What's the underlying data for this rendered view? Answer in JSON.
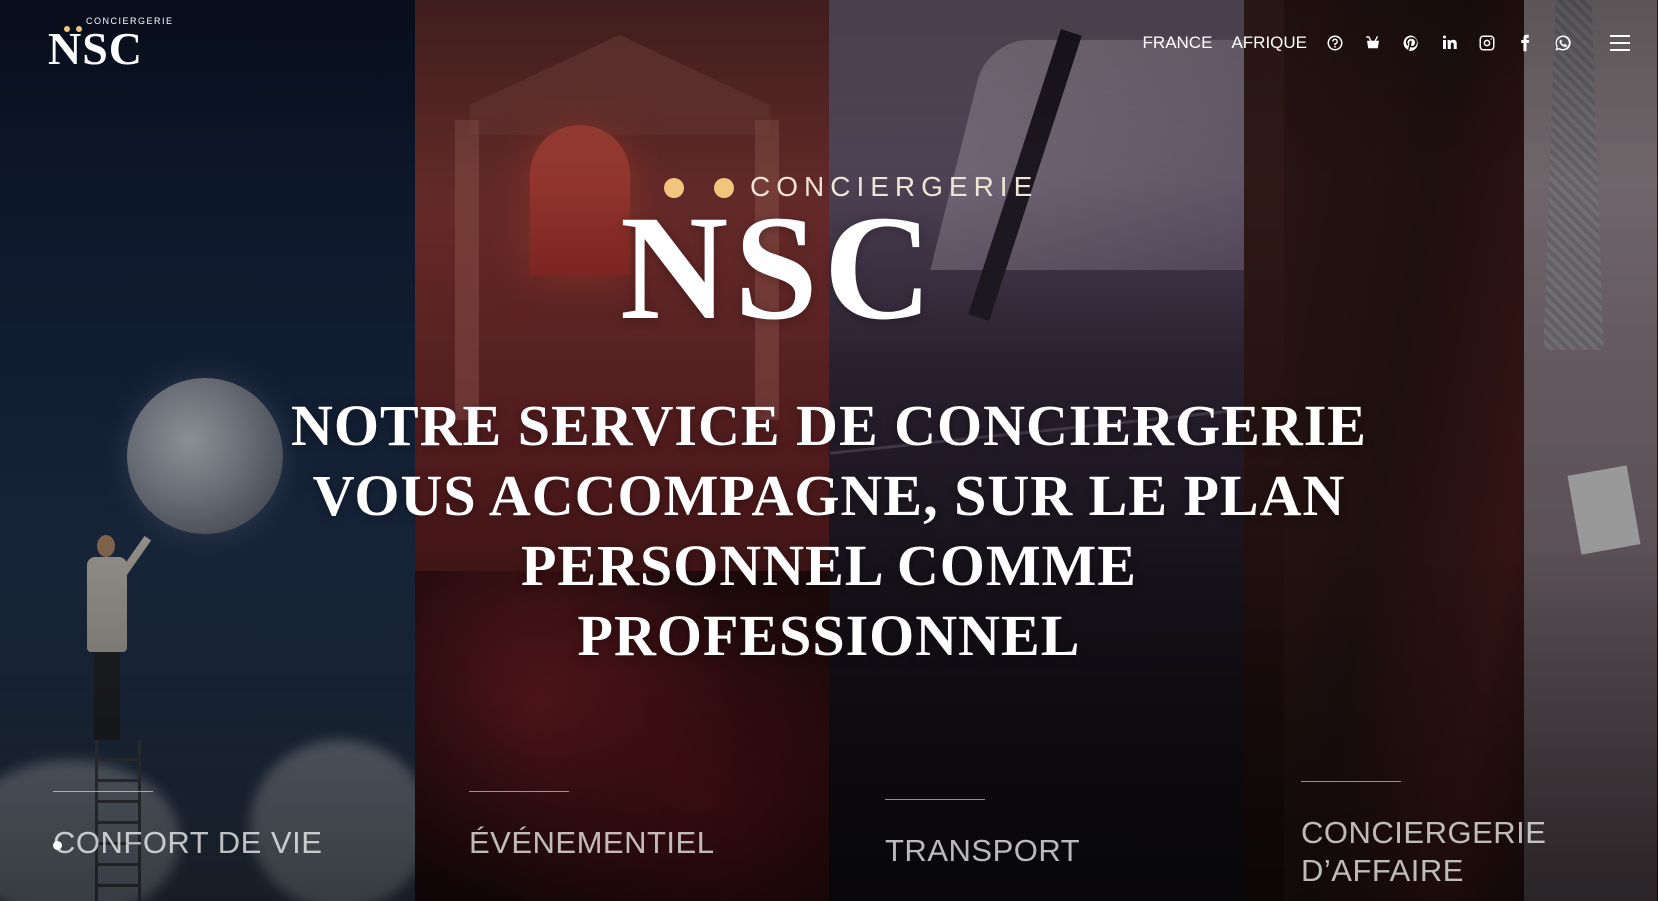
{
  "header": {
    "logo": {
      "word": "CONCIERGERIE",
      "letters": "NSC"
    },
    "nav_links": [
      "FRANCE",
      "AFRIQUE"
    ],
    "icons": [
      "question-circle-icon",
      "basket-icon",
      "pinterest-icon",
      "linkedin-icon",
      "instagram-icon",
      "facebook-icon",
      "whatsapp-icon",
      "hamburger-menu-icon"
    ]
  },
  "hero": {
    "logo": {
      "word": "CONCIERGERIE",
      "letters": "NSC"
    },
    "headline_lines": [
      "Notre service de conciergerie",
      "vous accompagne, sur le plan",
      "personnel comme professionnel"
    ]
  },
  "categories": [
    {
      "label": "CONFORT DE VIE"
    },
    {
      "label": "ÉVÉNEMENTIEL"
    },
    {
      "label": "TRANSPORT"
    },
    {
      "label": "CONCIERGERIE D’AFFAIRE"
    }
  ],
  "colors": {
    "gold": "#f2c57d",
    "text": "#ffffff"
  }
}
